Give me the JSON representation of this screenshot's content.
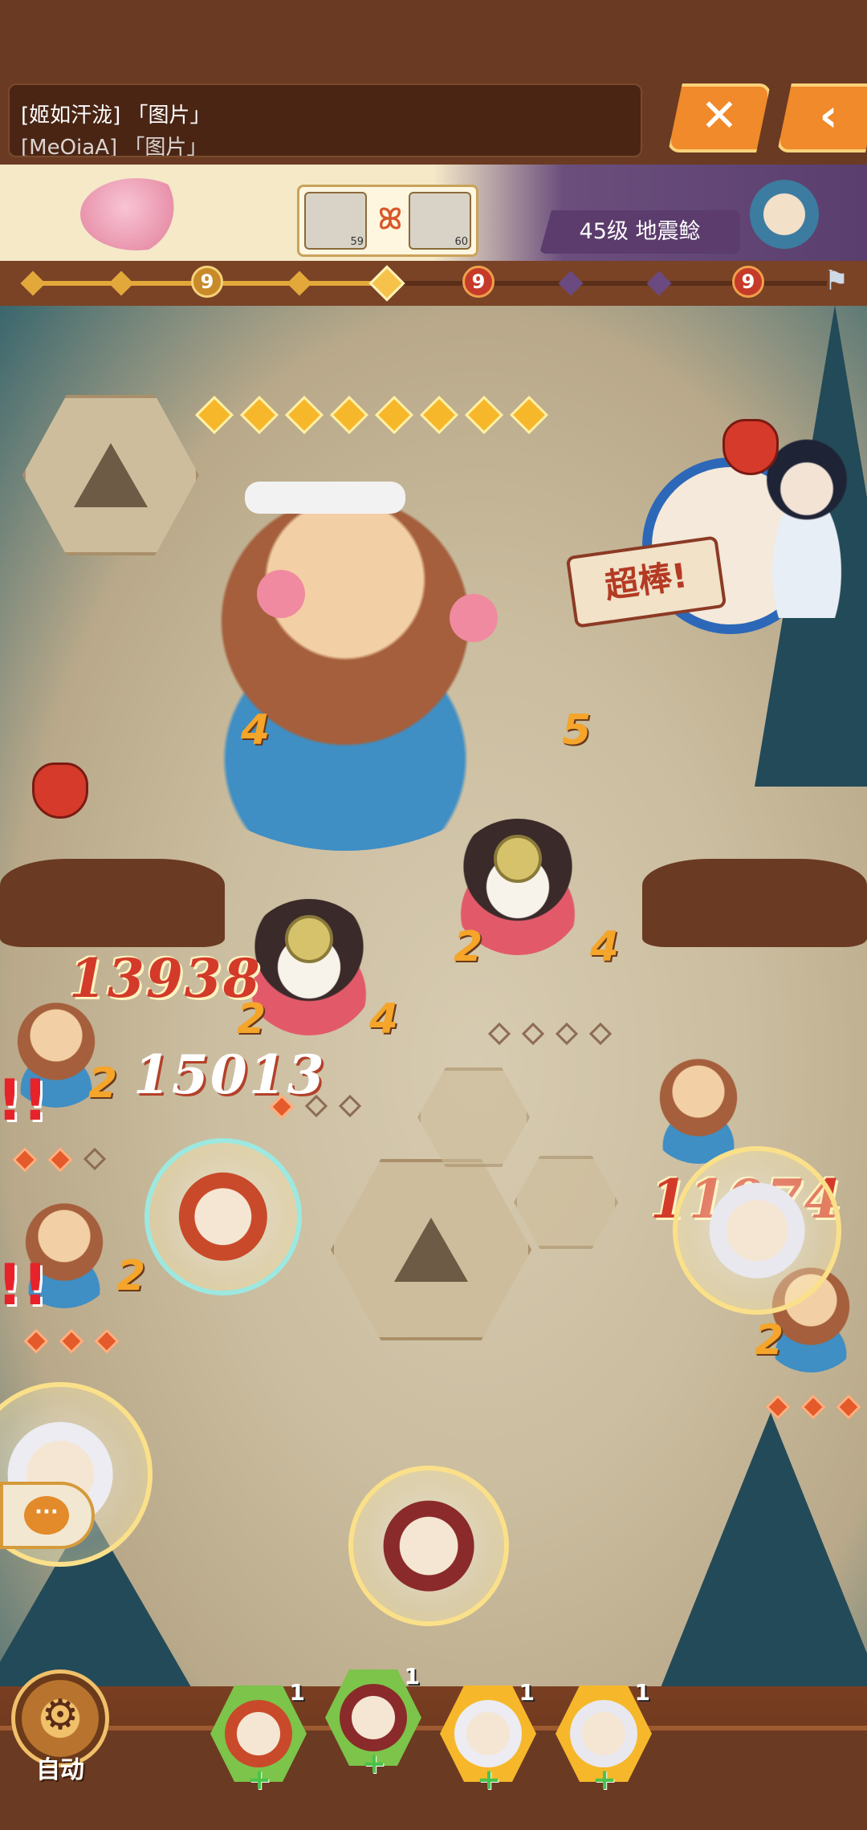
{
  "chat": {
    "line1": "[姬如汗泷] 「图片」",
    "line2": "[MeOiaA] 「图片」"
  },
  "nav": {
    "close_icon": "close-icon",
    "back_icon": "back-icon",
    "close_glyph": "✕",
    "back_glyph": "‹"
  },
  "team": {
    "slot1_level": "59",
    "slot2_level": "60",
    "link_glyph": "ꕤ"
  },
  "boss": {
    "label": "45级 地震鲶"
  },
  "track": {
    "boss_marker": "9"
  },
  "battle": {
    "praise_text": "超棒!",
    "damage_1": "13938",
    "damage_2": "15013",
    "damage_3": "11074",
    "boss_stat_left": "4",
    "boss_stat_right": "5",
    "samurai1_left": "2",
    "samurai1_right": "4",
    "samurai2_left": "2",
    "samurai2_right": "4",
    "minion1_stat": "2",
    "minion2_stat": "2",
    "minion3_stat": "2",
    "alert_glyph": "!!"
  },
  "chat_button": {
    "glyph": "···"
  },
  "controls": {
    "auto_label": "自动",
    "gear_glyph": "⚙",
    "skill_counts": [
      "1",
      "1",
      "1",
      "1"
    ],
    "plus_glyph": "+"
  },
  "colors": {
    "frame_brown": "#6b3a22",
    "accent_orange": "#f08a2a",
    "damage_red": "#d33a2a",
    "gold": "#f6b82a"
  }
}
